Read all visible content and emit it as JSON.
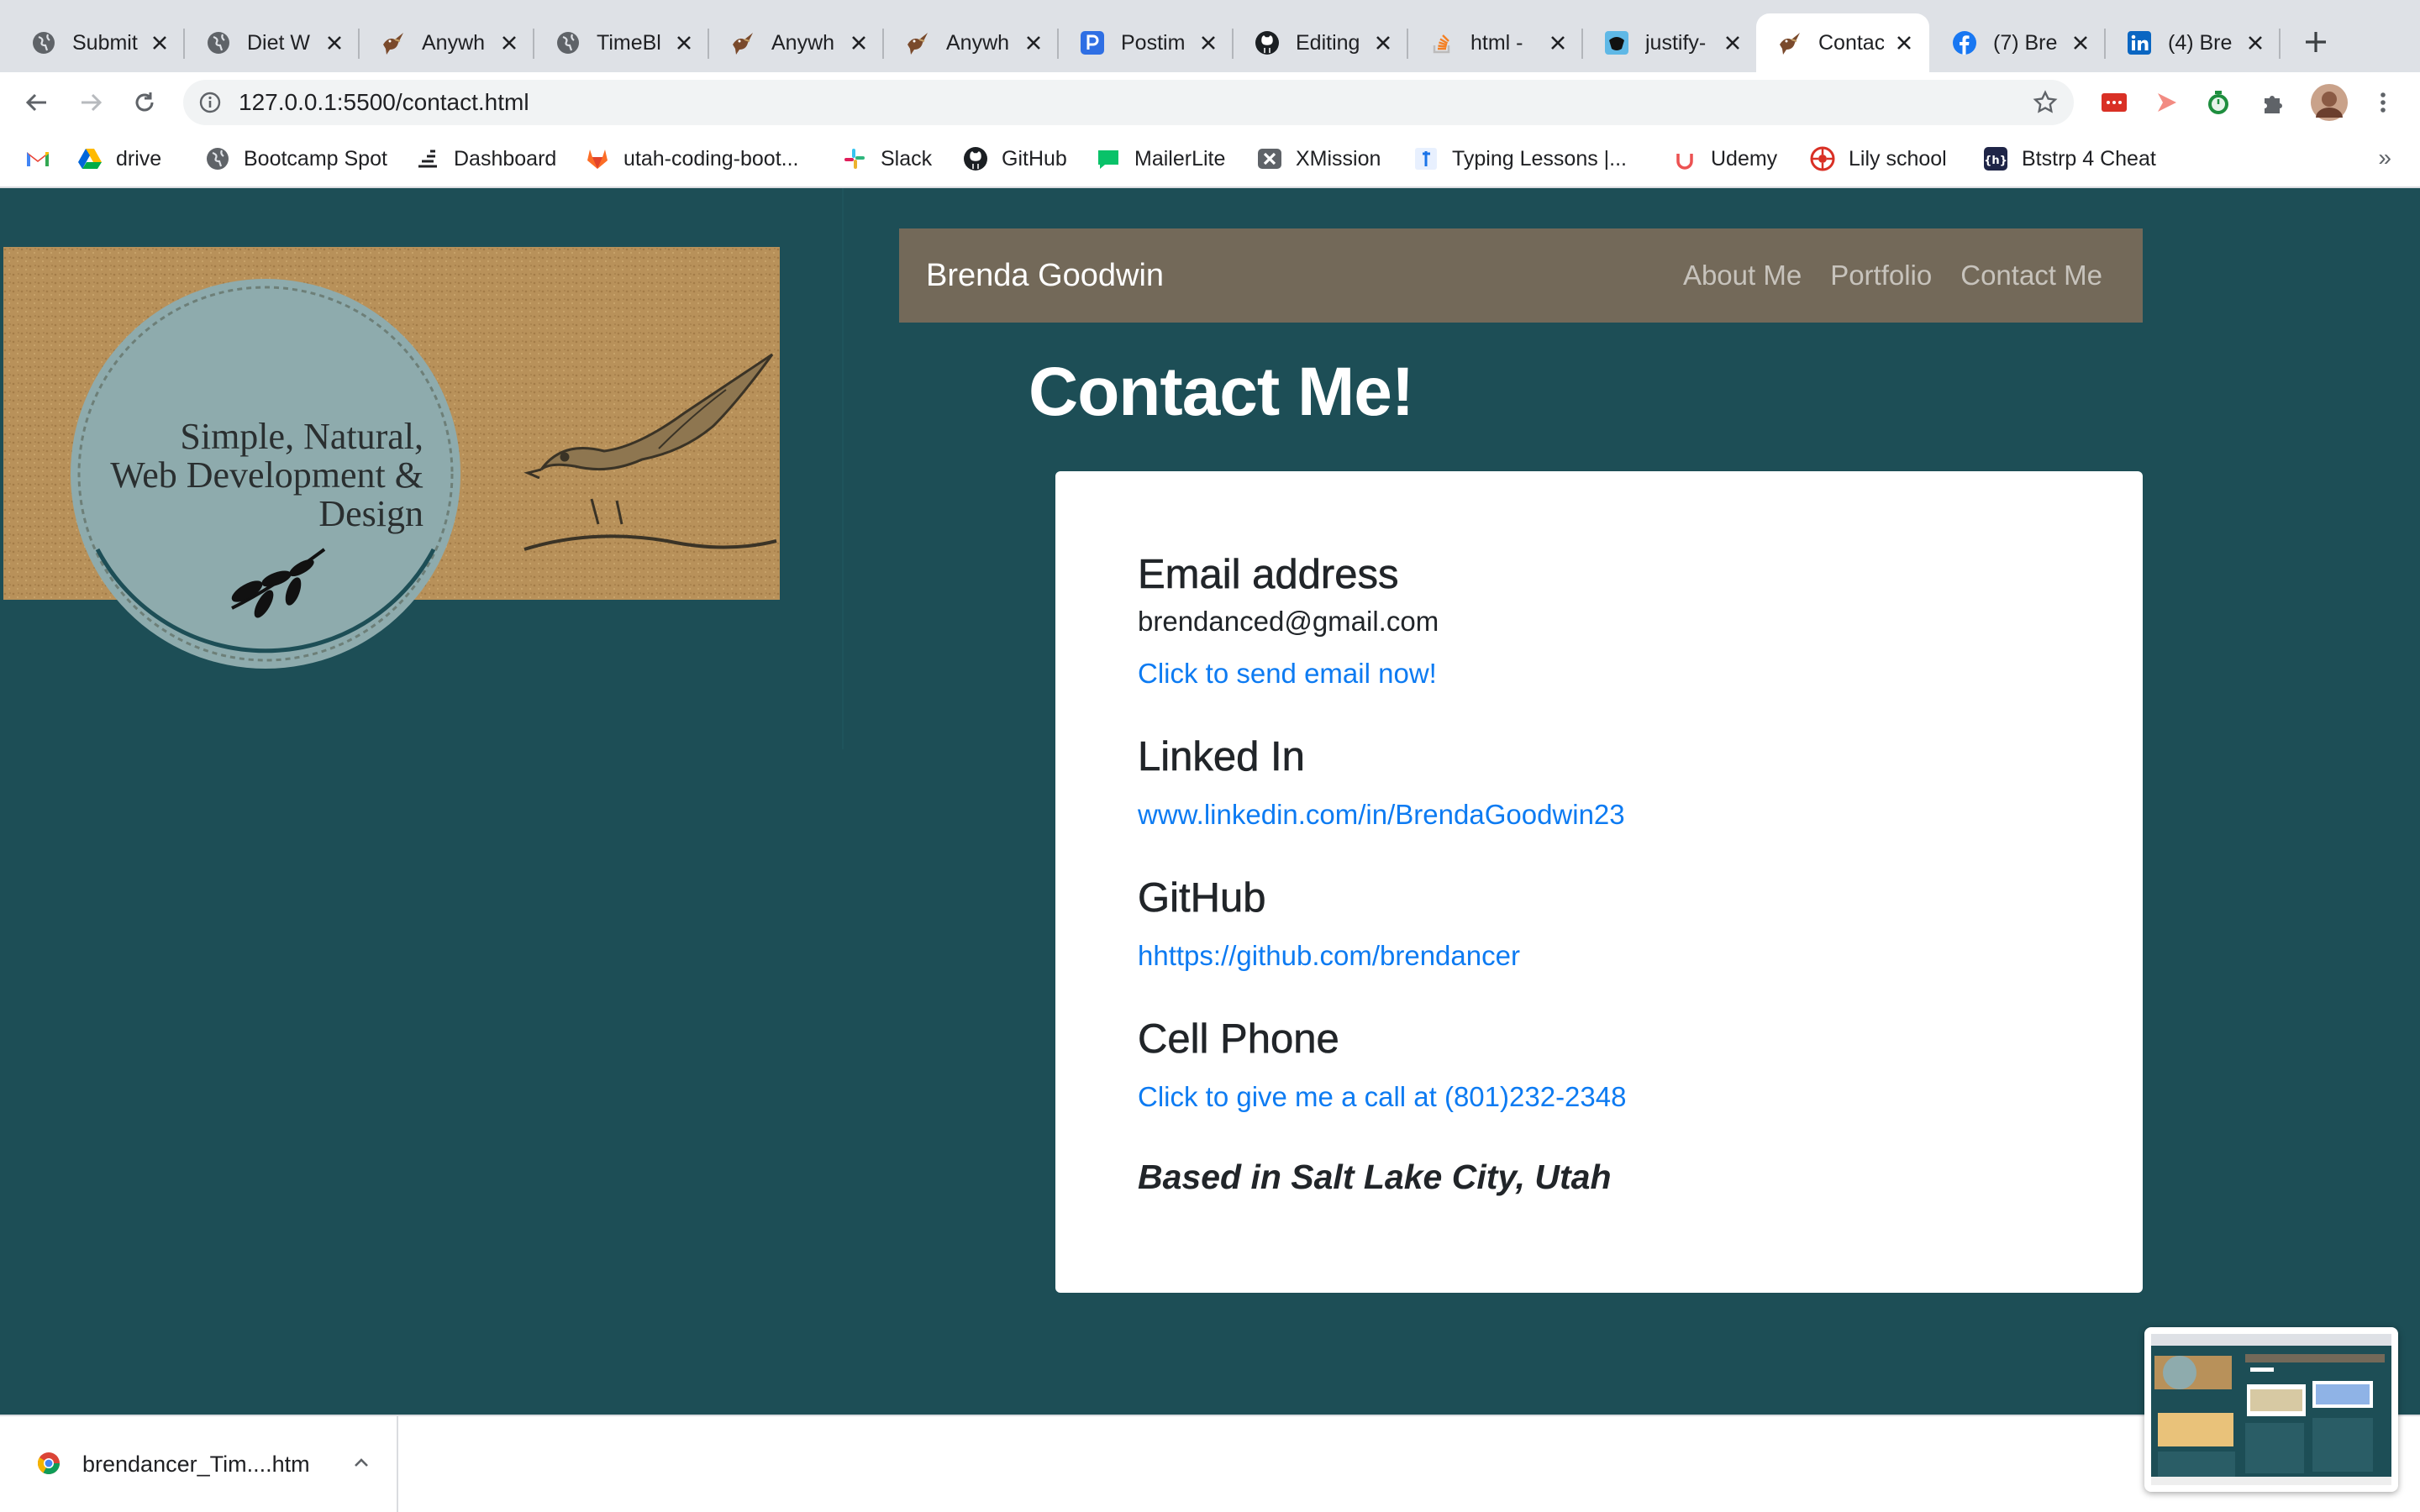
{
  "browser": {
    "tabs": [
      {
        "title": "Submit",
        "icon": "globe-icon"
      },
      {
        "title": "Diet W",
        "icon": "globe-icon"
      },
      {
        "title": "Anywh",
        "icon": "bird-icon"
      },
      {
        "title": "TimeBl",
        "icon": "globe-icon"
      },
      {
        "title": "Anywh",
        "icon": "bird-icon"
      },
      {
        "title": "Anywh",
        "icon": "bird-icon"
      },
      {
        "title": "Postim",
        "icon": "postimages-icon"
      },
      {
        "title": "Editing",
        "icon": "github-icon"
      },
      {
        "title": "html -",
        "icon": "stackoverflow-icon"
      },
      {
        "title": "justify-",
        "icon": "css-tricks-icon"
      },
      {
        "title": "Contac",
        "icon": "bird-icon",
        "active": true
      },
      {
        "title": "(7) Bre",
        "icon": "facebook-icon"
      },
      {
        "title": "(4) Bre",
        "icon": "linkedin-icon"
      }
    ],
    "url": "127.0.0.1:5500/contact.html",
    "bookmarks": [
      {
        "label": "",
        "icon": "gmail-icon"
      },
      {
        "label": "drive",
        "icon": "google-drive-icon"
      },
      {
        "label": "Bootcamp Spot",
        "icon": "globe-icon"
      },
      {
        "label": "Dashboard",
        "icon": "dashboard-icon"
      },
      {
        "label": "utah-coding-boot...",
        "icon": "gitlab-icon"
      },
      {
        "label": "Slack",
        "icon": "slack-icon"
      },
      {
        "label": "GitHub",
        "icon": "github-icon"
      },
      {
        "label": "MailerLite",
        "icon": "mailerlite-icon"
      },
      {
        "label": "XMission",
        "icon": "xmission-icon"
      },
      {
        "label": "Typing Lessons |...",
        "icon": "typing-icon"
      },
      {
        "label": "Udemy",
        "icon": "udemy-icon"
      },
      {
        "label": "Lily school",
        "icon": "lily-icon"
      },
      {
        "label": "Btstrp 4 Cheat",
        "icon": "bootstrap-cheat-icon"
      }
    ],
    "bookmarks_more": "»",
    "colors": {
      "tabstrip": "#dee1e6",
      "toolbar": "#ffffff"
    }
  },
  "site": {
    "banner_text": [
      "Simple, Natural,",
      "Web Development &",
      "Design"
    ],
    "brand": "Brenda Goodwin",
    "nav": [
      "About Me",
      "Portfolio",
      "Contact Me"
    ],
    "heading": "Contact Me!",
    "contact": {
      "email_heading": "Email address",
      "email": "brendanced@gmail.com",
      "email_link": "Click to send email now!",
      "linkedin_heading": "Linked In",
      "linkedin_link": "www.linkedin.com/in/BrendaGoodwin23",
      "github_heading": "GitHub",
      "github_link": "hhttps://github.com/brendancer",
      "phone_heading": "Cell Phone",
      "phone_link": "Click to give me a call at (801)232-2348",
      "location": "Based in Salt Lake City, Utah"
    },
    "colors": {
      "background": "#1d4e56",
      "navbar": "#736959",
      "link": "#0d7bf2",
      "card": "#ffffff"
    }
  },
  "downloads": {
    "filename": "brendancer_Tim....htm"
  }
}
